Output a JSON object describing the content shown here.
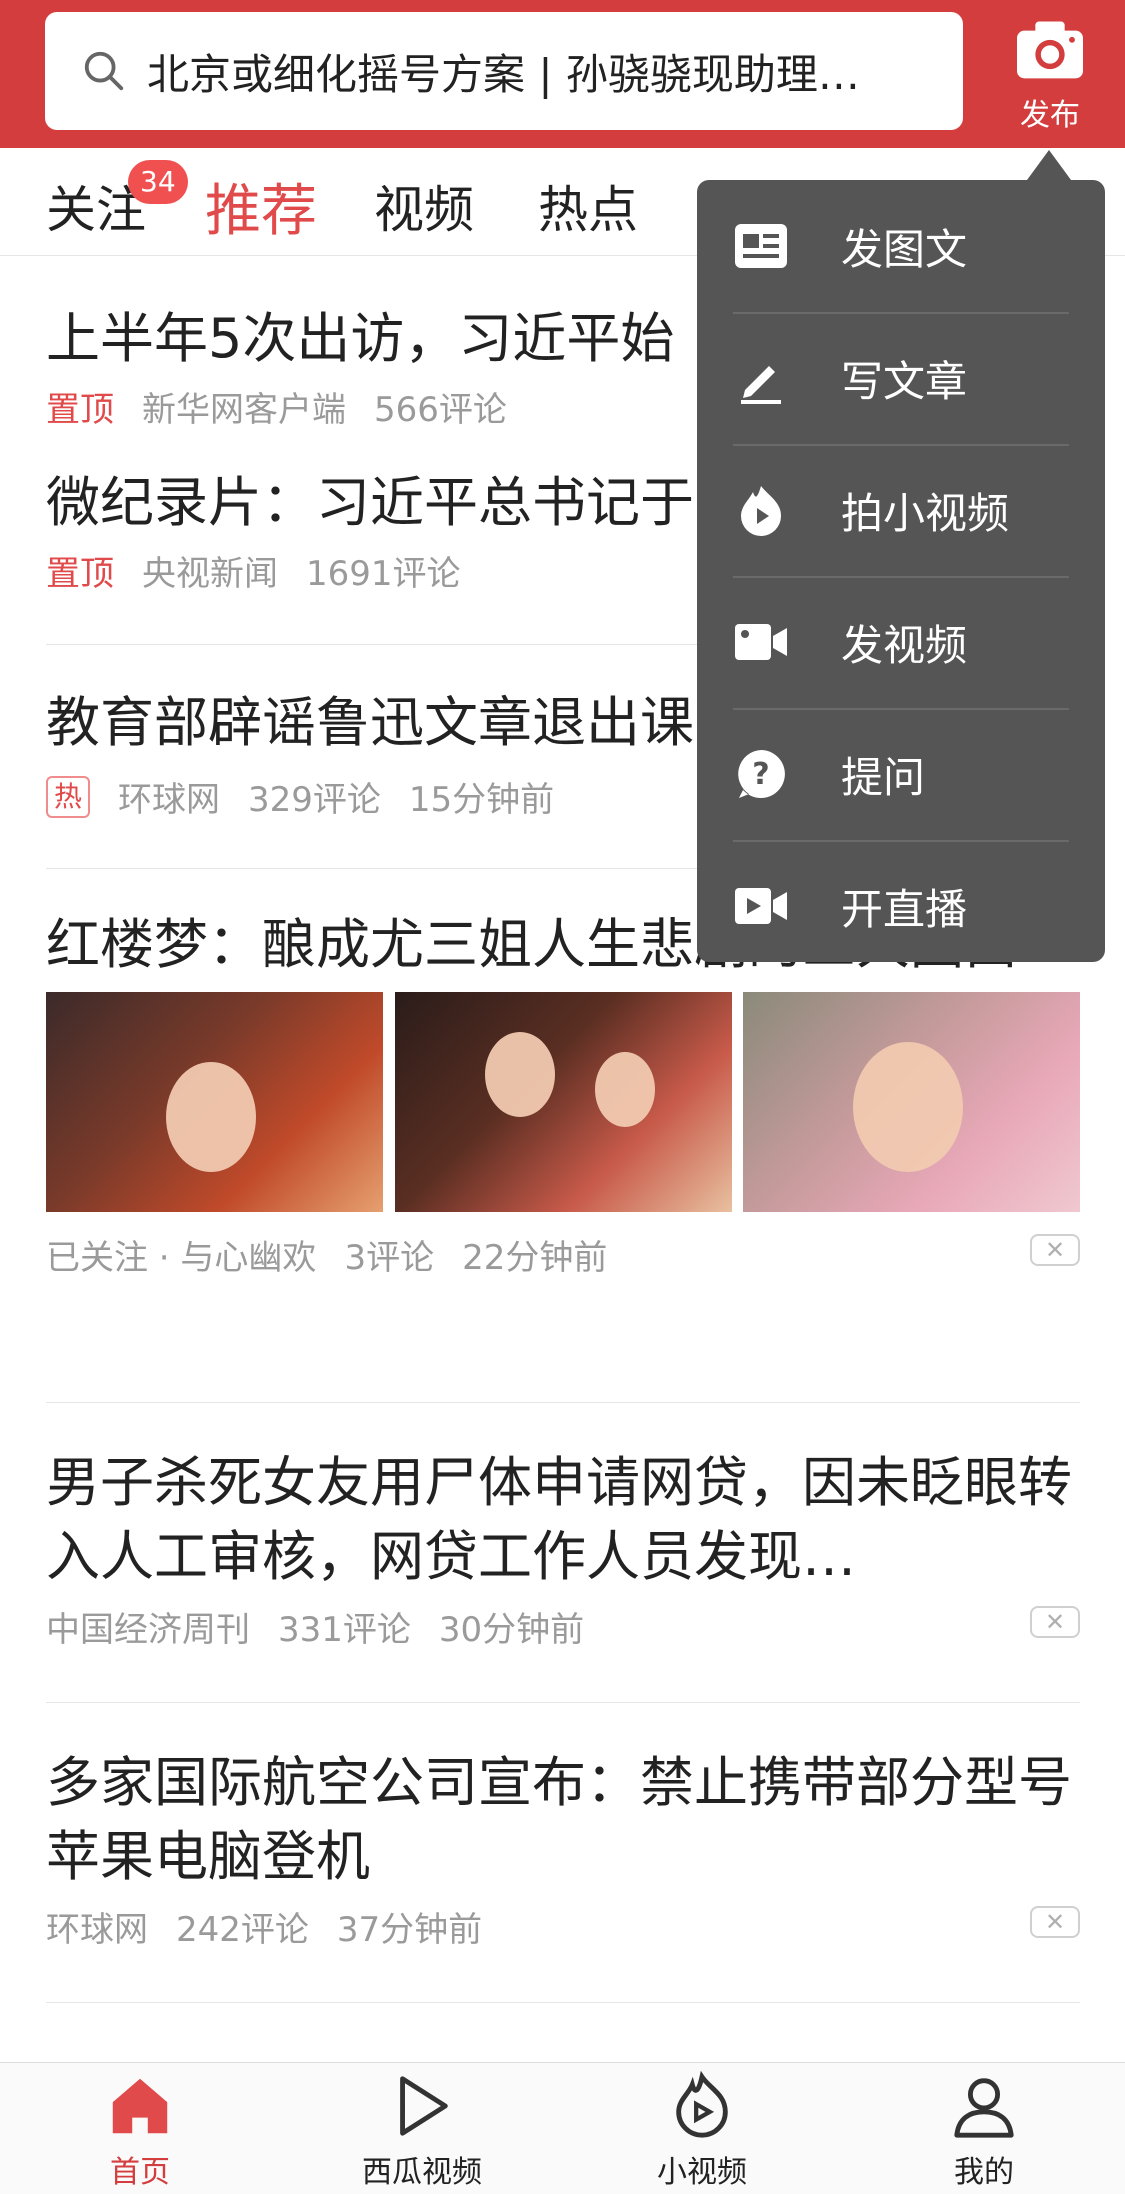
{
  "header": {
    "search_text": "北京或细化摇号方案 | 孙骁骁现助理…",
    "publish_label": "发布"
  },
  "tabs": {
    "follow": "关注",
    "follow_badge": "34",
    "recommend": "推荐",
    "video": "视频",
    "hot": "热点"
  },
  "feed": [
    {
      "title": "上半年5次出访，习近平始",
      "tag": "置顶",
      "source": "新华网客户端",
      "comments": "566评论"
    },
    {
      "title": "微纪录片：习近平总书记于",
      "tag": "置顶",
      "source": "央视新闻",
      "comments": "1691评论"
    },
    {
      "title": "教育部辟谣鲁迅文章退出课",
      "hot_tag": "热",
      "source": "环球网",
      "comments": "329评论",
      "time": "15分钟前"
    },
    {
      "title": "红楼梦：酿成尤三姐人生悲剧的三大因由",
      "source": "已关注 · 与心幽欢",
      "comments": "3评论",
      "time": "22分钟前"
    },
    {
      "title": "男子杀死女友用尸体申请网贷，因未眨眼转入人工审核，网贷工作人员发现…",
      "source": "中国经济周刊",
      "comments": "331评论",
      "time": "30分钟前"
    },
    {
      "title": "多家国际航空公司宣布：禁止携带部分型号苹果电脑登机",
      "source": "环球网",
      "comments": "242评论",
      "time": "37分钟前"
    }
  ],
  "menu": {
    "items": [
      {
        "label": "发图文",
        "icon": "image-text-icon"
      },
      {
        "label": "写文章",
        "icon": "pen-icon"
      },
      {
        "label": "拍小视频",
        "icon": "flame-video-icon"
      },
      {
        "label": "发视频",
        "icon": "video-camera-icon"
      },
      {
        "label": "提问",
        "icon": "question-icon"
      },
      {
        "label": "开直播",
        "icon": "live-icon"
      }
    ]
  },
  "bottom_nav": {
    "home": "首页",
    "xigua": "西瓜视频",
    "short_video": "小视频",
    "mine": "我的"
  },
  "colors": {
    "brand_red": "#d43d3d",
    "menu_bg": "#555555"
  }
}
